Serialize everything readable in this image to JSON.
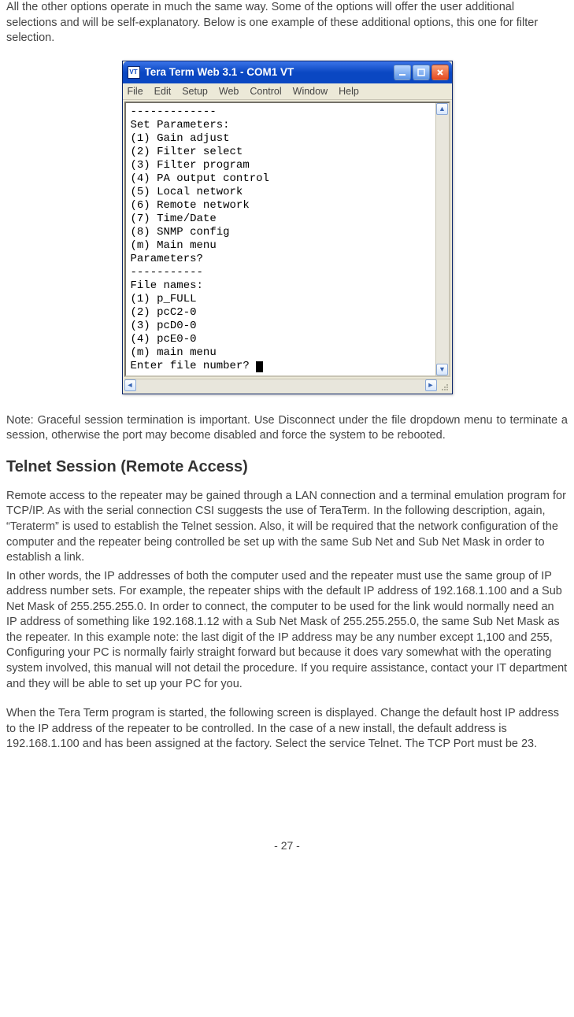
{
  "intro_paragraph": "All the other options operate in much the same way. Some of the options will offer the user additional selections and will be self-explanatory. Below is one example of these additional options, this one for filter selection.",
  "tera_term": {
    "app_icon_text": "VT",
    "title": "Tera Term Web 3.1 - COM1 VT",
    "menu": [
      "File",
      "Edit",
      "Setup",
      "Web",
      "Control",
      "Window",
      "Help"
    ],
    "terminal_text": "-------------\nSet Parameters:\n(1) Gain adjust\n(2) Filter select\n(3) Filter program\n(4) PA output control\n(5) Local network\n(6) Remote network\n(7) Time/Date\n(8) SNMP config\n(m) Main menu\nParameters?\n-----------\nFile names:\n(1) p_FULL\n(2) pcC2-0\n(3) pcD0-0\n(4) pcE0-0\n(m) main menu\nEnter file number? "
  },
  "note_paragraph": "Note: Graceful session termination is important. Use Disconnect under the file dropdown menu to terminate a session, otherwise the port may become disabled and force the system to be rebooted.",
  "section_heading": "Telnet Session (Remote Access)",
  "telnet_p1": "Remote access to the repeater may be gained through a LAN connection and a terminal emulation program for TCP/IP. As with the serial connection CSI suggests the use of TeraTerm. In the following description, again, “Teraterm” is used to establish the Telnet session. Also, it will be required that the network configuration of the computer and the repeater being controlled be set up with the same Sub Net and Sub Net Mask in order to establish a link.",
  "telnet_p2": "In other words, the IP addresses of both the computer used and the repeater must use the same group of IP address number sets. For example, the repeater ships with the default IP address of 192.168.1.100 and a Sub Net Mask of 255.255.255.0. In order to connect, the computer to be used for the link would normally need an IP address of something like 192.168.1.12 with a Sub Net Mask of 255.255.255.0, the same Sub Net Mask as the repeater. In this example note: the last digit of the IP address may be any number except 1,100 and 255,  Configuring your PC is normally fairly straight forward but because it does vary somewhat with the operating system involved, this manual will not detail the procedure. If you require assistance, contact your IT department and they will be able to set up your PC for you.",
  "telnet_p3": "When the Tera Term program is started, the following screen is displayed. Change the default host IP address to the IP address of the repeater to be controlled. In the case of a new install, the default address is 192.168.1.100 and has been assigned at the factory. Select the service Telnet. The TCP Port must be 23.",
  "page_number": "- 27 -"
}
